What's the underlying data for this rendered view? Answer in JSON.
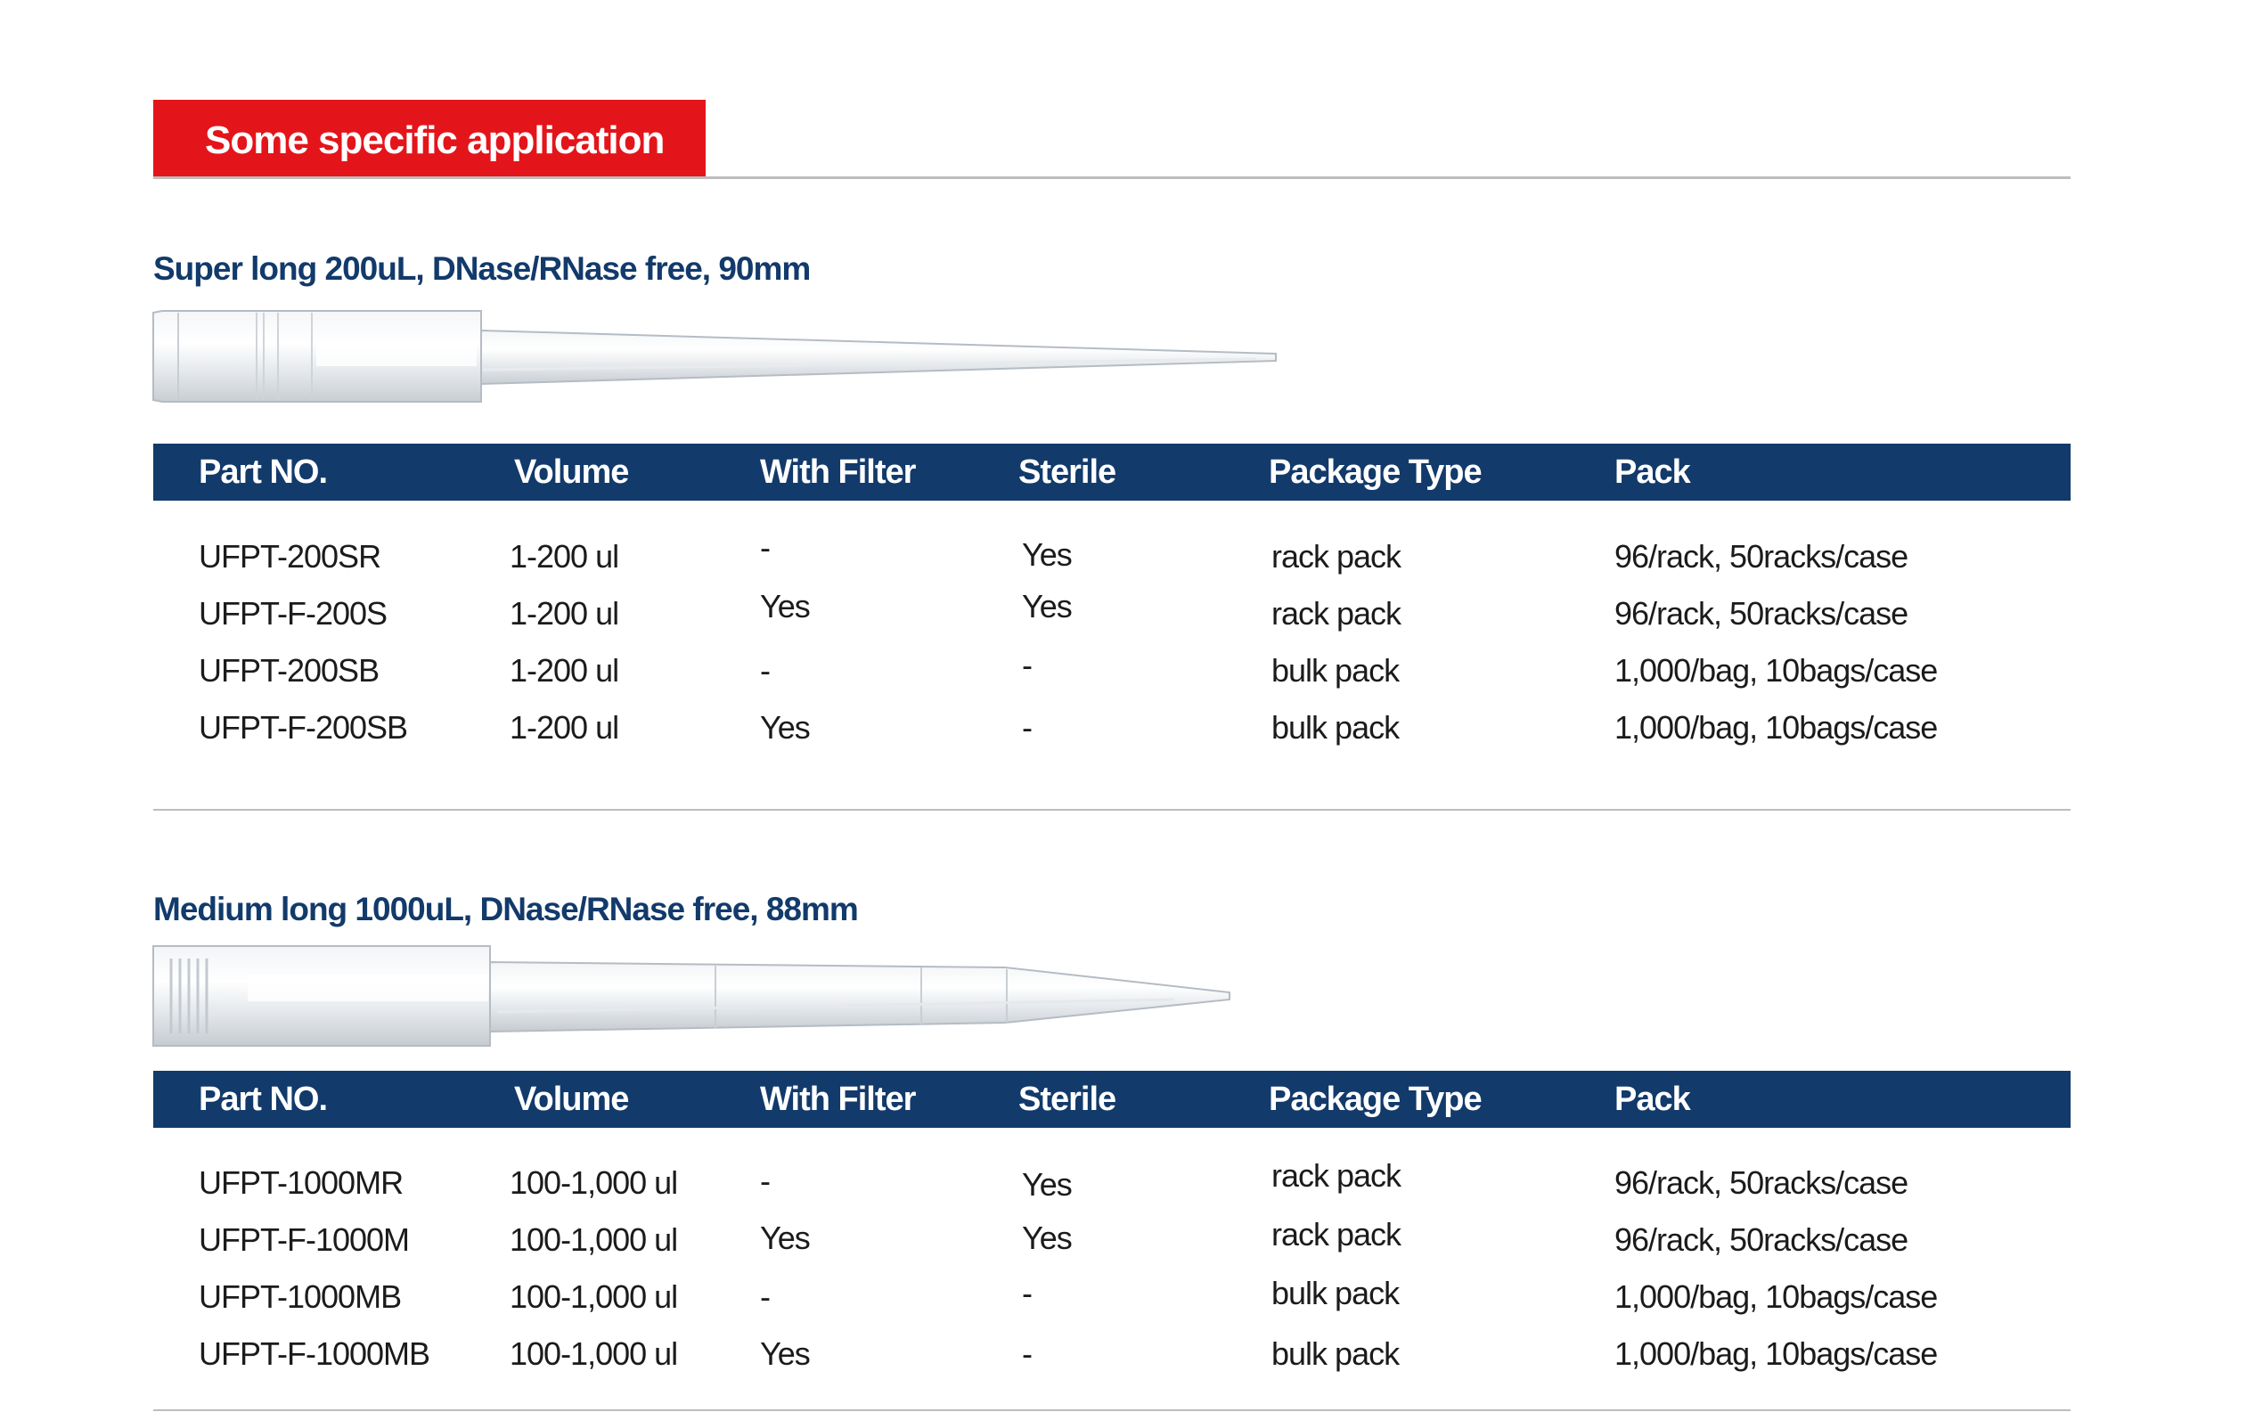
{
  "header": {
    "title": "Some specific application"
  },
  "columns": [
    "Part NO.",
    "Volume",
    "With Filter",
    "Sterile",
    "Package Type",
    "Pack"
  ],
  "sections": [
    {
      "title": "Super long 200uL, DNase/RNase free, 90mm",
      "image": "pipette-tip-200ul",
      "rows": [
        [
          "UFPT-200SR",
          "1-200 ul",
          "-",
          "Yes",
          "rack pack",
          "96/rack, 50racks/case"
        ],
        [
          "UFPT-F-200S",
          "1-200 ul",
          "Yes",
          "Yes",
          "rack pack",
          "96/rack, 50racks/case"
        ],
        [
          "UFPT-200SB",
          "1-200 ul",
          "-",
          "-",
          "bulk pack",
          "1,000/bag, 10bags/case"
        ],
        [
          "UFPT-F-200SB",
          "1-200 ul",
          "Yes",
          "-",
          "bulk pack",
          "1,000/bag, 10bags/case"
        ]
      ]
    },
    {
      "title": "Medium long 1000uL, DNase/RNase free, 88mm",
      "image": "pipette-tip-1000ul",
      "rows": [
        [
          "UFPT-1000MR",
          "100-1,000 ul",
          "-",
          "Yes",
          "rack pack",
          "96/rack, 50racks/case"
        ],
        [
          "UFPT-F-1000M",
          "100-1,000 ul",
          "Yes",
          "Yes",
          "rack pack",
          "96/rack, 50racks/case"
        ],
        [
          "UFPT-1000MB",
          "100-1,000 ul",
          "-",
          "-",
          "bulk pack",
          "1,000/bag, 10bags/case"
        ],
        [
          "UFPT-F-1000MB",
          "100-1,000 ul",
          "Yes",
          "-",
          "bulk pack",
          "1,000/bag, 10bags/case"
        ]
      ]
    }
  ],
  "colors": {
    "accent_red": "#e3151b",
    "navy": "#123a6b",
    "rule_gray": "#bdbdbd"
  }
}
